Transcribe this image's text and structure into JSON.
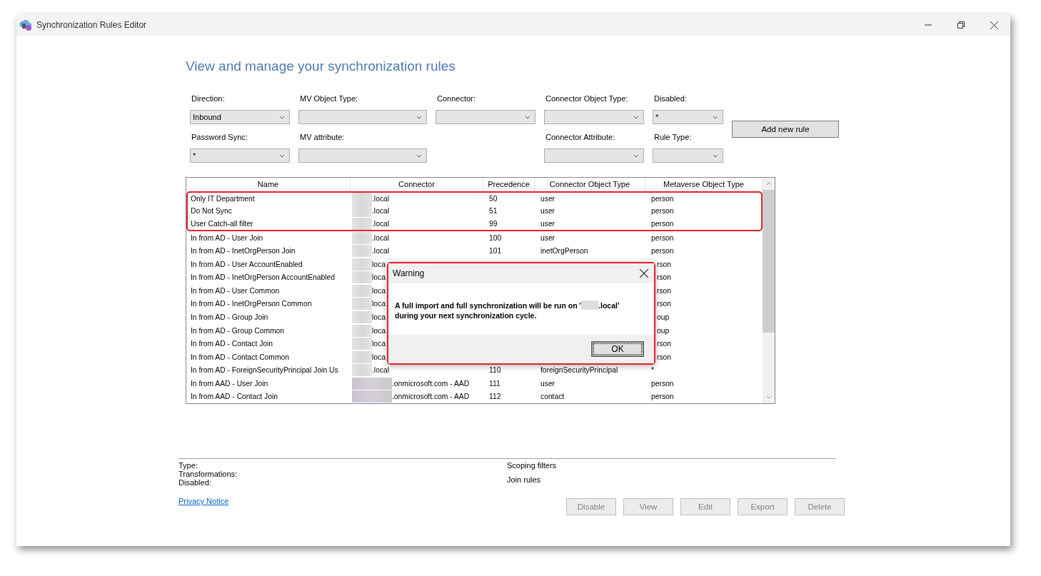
{
  "window": {
    "title": "Synchronization Rules Editor"
  },
  "heading": "View and manage your synchronization rules",
  "filters": [
    {
      "label": "Direction:",
      "value": "Inbound"
    },
    {
      "label": "MV Object Type:"
    },
    {
      "label": "Connector:"
    },
    {
      "label": "Connector Object Type:"
    },
    {
      "label": "Disabled:",
      "value": "*"
    },
    {
      "label": "Password Sync:",
      "value": "*"
    },
    {
      "label": "MV attribute:"
    },
    {
      "label": "Connector Attribute:"
    },
    {
      "label": "Rule Type:"
    }
  ],
  "add_button": "Add new rule",
  "table": {
    "columns": [
      "Name",
      "Connector",
      "Precedence",
      "Connector Object Type",
      "Metaverse Object Type"
    ],
    "rows": [
      {
        "name": "Only IT Department",
        "connector": ".local",
        "precedence": "50",
        "connector_object_type": "user",
        "metaverse_object_type": "person",
        "redacted": true,
        "highlighted": true
      },
      {
        "name": "Do Not Sync",
        "connector": ".local",
        "precedence": "51",
        "connector_object_type": "user",
        "metaverse_object_type": "person",
        "redacted": true,
        "highlighted": true
      },
      {
        "name": "User Catch-all filter",
        "connector": ".local",
        "precedence": "99",
        "connector_object_type": "user",
        "metaverse_object_type": "person",
        "redacted": true,
        "highlighted": true
      },
      {
        "name": "In from AD - User Join",
        "connector": ".local",
        "precedence": "100",
        "connector_object_type": "user",
        "metaverse_object_type": "person",
        "redacted": true,
        "highlighted": false
      },
      {
        "name": "In from AD - InetOrgPerson Join",
        "connector": ".local",
        "precedence": "101",
        "connector_object_type": "inetOrgPerson",
        "metaverse_object_type": "person",
        "redacted": true,
        "highlighted": false
      },
      {
        "name": "In from AD - User AccountEnabled",
        "connector": "loca",
        "metaverse_object_type": "rson",
        "redacted": true,
        "highlighted": false
      },
      {
        "name": "In from AD - InetOrgPerson AccountEnabled",
        "connector": "loca",
        "metaverse_object_type": "rson",
        "redacted": true,
        "highlighted": false
      },
      {
        "name": "In from AD - User Common",
        "connector": "loca",
        "metaverse_object_type": "rson",
        "redacted": true,
        "highlighted": false
      },
      {
        "name": "In from AD - InetOrgPerson Common",
        "connector": "loca",
        "metaverse_object_type": "rson",
        "redacted": true,
        "highlighted": false
      },
      {
        "name": "In from AD - Group Join",
        "connector": "loca",
        "metaverse_object_type": "oup",
        "redacted": true,
        "highlighted": false
      },
      {
        "name": "In from AD - Group Common",
        "connector": "loca",
        "metaverse_object_type": "oup",
        "redacted": true,
        "highlighted": false
      },
      {
        "name": "In from AD - Contact Join",
        "connector": "loca",
        "metaverse_object_type": "rson",
        "redacted": true,
        "highlighted": false
      },
      {
        "name": "In from AD - Contact Common",
        "connector": "loca",
        "metaverse_object_type": "rson",
        "redacted": true,
        "highlighted": false
      },
      {
        "name": "In from AD - ForeignSecurityPrincipal Join Us",
        "connector": ".local",
        "precedence": "110",
        "connector_object_type": "foreignSecurityPrincipal",
        "metaverse_object_type": "*",
        "redacted": true,
        "highlighted": false
      },
      {
        "name": "In from AAD - User Join",
        "connector": ".onmicrosoft.com - AAD",
        "precedence": "111",
        "connector_object_type": "user",
        "metaverse_object_type": "person",
        "redacted": true,
        "highlighted": false
      },
      {
        "name": "In from AAD - Contact Join",
        "connector": ".onmicrosoft.com - AAD",
        "precedence": "112",
        "connector_object_type": "contact",
        "metaverse_object_type": "person",
        "redacted": true,
        "highlighted": false
      }
    ]
  },
  "details": {
    "left": [
      "Type:",
      "Transformations:",
      "Disabled:"
    ],
    "right": [
      "Scoping filters",
      "Join rules"
    ]
  },
  "privacy_link": "Privacy Notice",
  "buttons": [
    {
      "label": "Disable",
      "disabled": true
    },
    {
      "label": "View",
      "disabled": true
    },
    {
      "label": "Edit",
      "disabled": true
    },
    {
      "label": "Export",
      "disabled": true
    },
    {
      "label": "Delete",
      "disabled": true
    }
  ],
  "dialog": {
    "title": "Warning",
    "message_start": "A full import and full synchronization will be run on '",
    "message_host": ".local'",
    "message_end": "during your next synchronization cycle.",
    "ok_button": "OK",
    "highlighted": true
  }
}
